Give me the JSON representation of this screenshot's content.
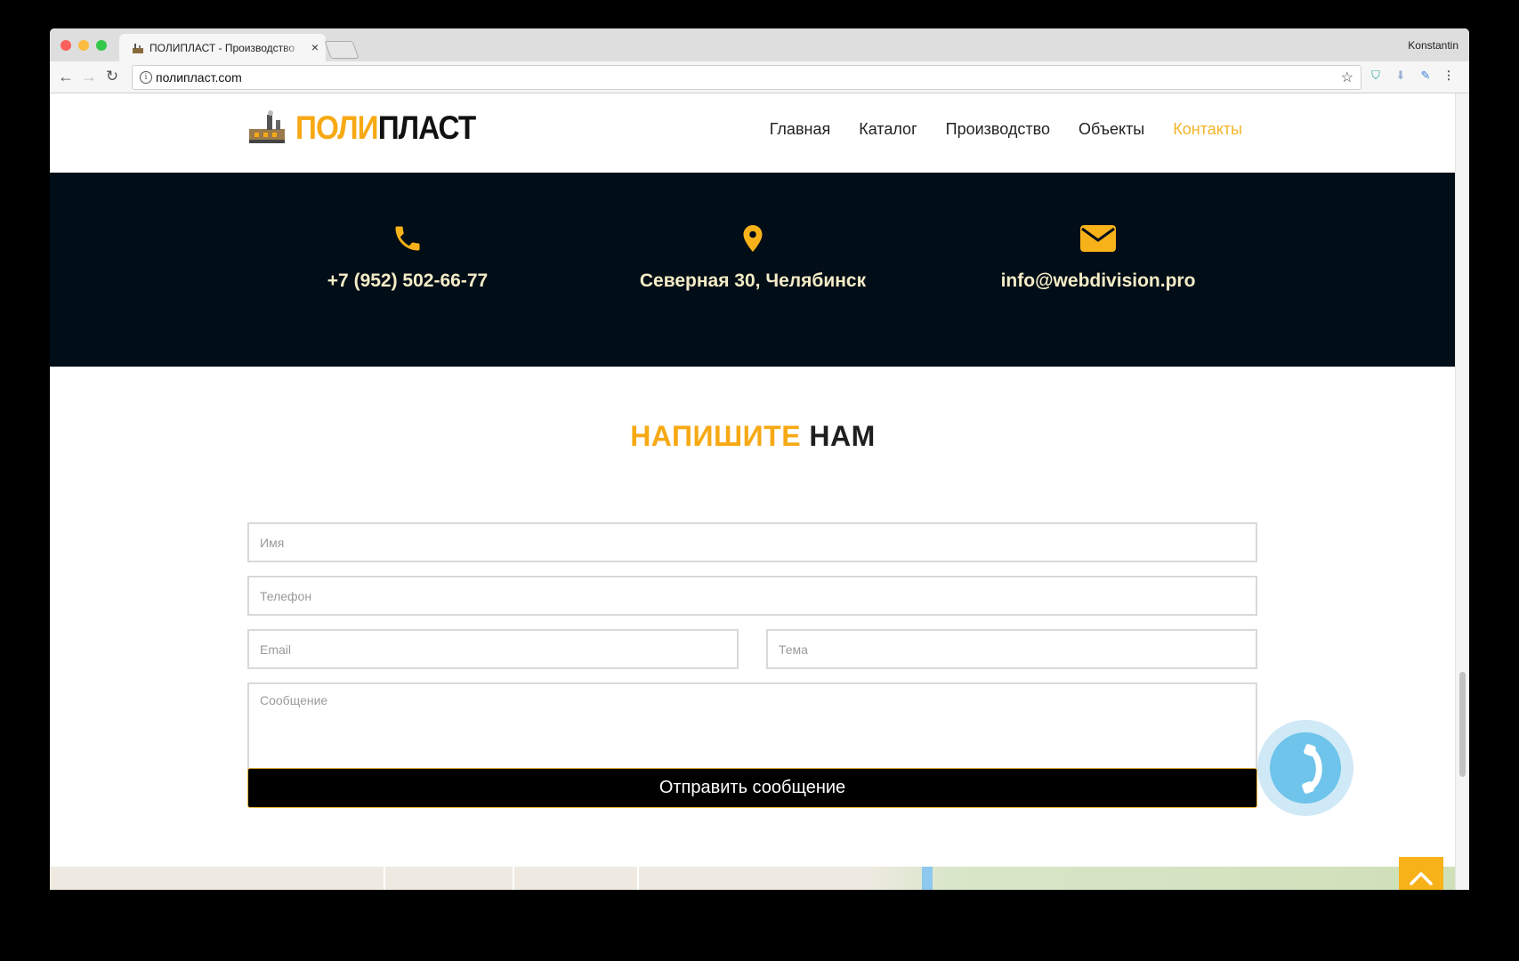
{
  "browser": {
    "tab_title": "ПОЛИПЛАСТ - Производство",
    "tab_close": "×",
    "profile_name": "Konstantin",
    "url": "полипласт.com"
  },
  "site": {
    "logo_part1": "ПОЛИ",
    "logo_part2": "ПЛАСТ",
    "nav": [
      {
        "label": "Главная"
      },
      {
        "label": "Каталог"
      },
      {
        "label": "Производство"
      },
      {
        "label": "Объекты"
      },
      {
        "label": "Контакты",
        "active": true
      }
    ],
    "accent_color": "#f7a914"
  },
  "contacts": {
    "phone": "+7 (952) 502-66-77",
    "address": "Северная 30, Челябинск",
    "email": "info@webdivision.pro",
    "icons": [
      "phone-icon",
      "map-pin-icon",
      "envelope-icon"
    ]
  },
  "form": {
    "title_part1": "НАПИШИТЕ",
    "title_part2": "НАМ",
    "name_placeholder": "Имя",
    "phone_placeholder": "Телефон",
    "email_placeholder": "Email",
    "subject_placeholder": "Тема",
    "message_placeholder": "Сообщение",
    "submit_label": "Отправить сообщение"
  }
}
